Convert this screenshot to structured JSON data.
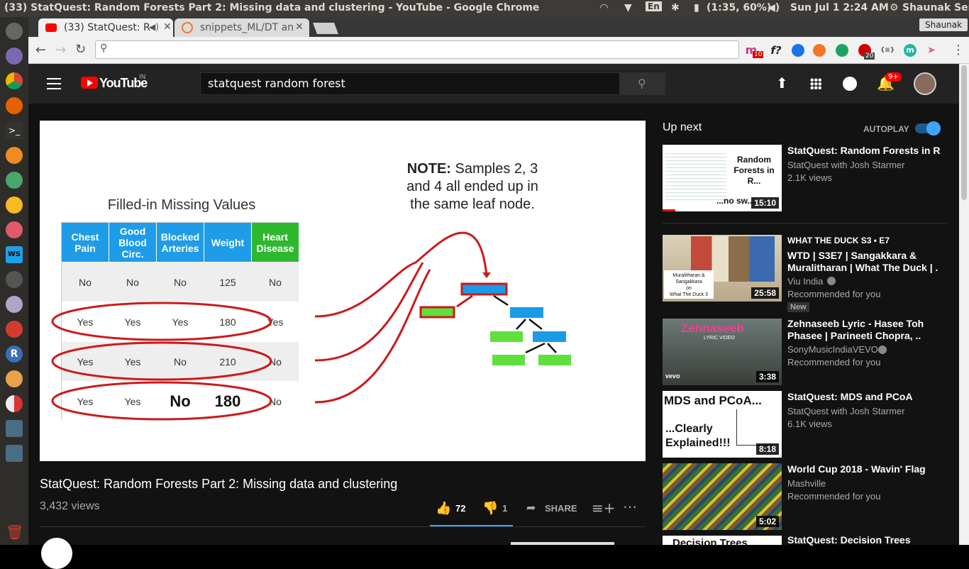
{
  "system": {
    "window_title": "(33) StatQuest: Random Forests Part 2: Missing data and clustering - YouTube - Google Chrome",
    "keyboard_layout": "En",
    "battery": "(1:35, 60%)",
    "datetime": "Sun Jul  1  2:24 AM",
    "user": "Shaunak Sen"
  },
  "browser": {
    "profile": "Shaunak",
    "tabs": [
      {
        "label": "(33) StatQuest: R",
        "active": true
      },
      {
        "label": "snippets_ML/DT an",
        "active": false
      }
    ],
    "address": "",
    "extensions": {
      "badge1": "10",
      "fx": "f?",
      "badge2": "20",
      "braces": "{≡}",
      "m": "m"
    }
  },
  "youtube": {
    "logo_text": "YouTube",
    "region": "IN",
    "search_value": "statquest random forest",
    "notifications_badge": "9+"
  },
  "slide": {
    "table_title": "Filled-in Missing Values",
    "note_bold": "NOTE:",
    "note_line1": " Samples 2, 3",
    "note_line2": "and 4 all ended up in",
    "note_line3": "the same leaf node.",
    "headers": [
      "Chest Pain",
      "Good Blood Circ.",
      "Blocked Arteries",
      "Weight",
      "Heart Disease"
    ],
    "rows": [
      [
        "No",
        "No",
        "No",
        "125",
        "No"
      ],
      [
        "Yes",
        "Yes",
        "Yes",
        "180",
        "Yes"
      ],
      [
        "Yes",
        "Yes",
        "No",
        "210",
        "No"
      ],
      [
        "Yes",
        "Yes",
        "No",
        "180",
        "No"
      ]
    ]
  },
  "video": {
    "title": "StatQuest: Random Forests Part 2: Missing data and clustering",
    "views": "3,432 views",
    "likes": "72",
    "dislikes": "1",
    "share": "SHARE"
  },
  "sidebar": {
    "heading": "Up next",
    "autoplay": "AUTOPLAY",
    "autoplay_on": true,
    "videos": [
      {
        "title": "StatQuest: Random Forests in R",
        "channel": "StatQuest with Josh Starmer",
        "meta": "2.1K views",
        "duration": "15:10",
        "thumb_line1": "Random",
        "thumb_line2": "Forests in",
        "thumb_line3": "R...",
        "thumb_line4": "...no sw..."
      },
      {
        "title": "WTD | S3E7 | Sangakkara & Muralitharan | What The Duck | .",
        "channel": "Viu India",
        "meta": "Recommended for you",
        "duration": "25:58",
        "tag": "WHAT THE DUCK  S3 • E7",
        "badge": "New",
        "thumb_line1": "Muralitharan &",
        "thumb_line2": "Sangakkara",
        "thumb_line3": "on",
        "thumb_line4": "What The Duck 3"
      },
      {
        "title": "Zehnaseeb Lyric - Hasee Toh Phasee | Parineeti Chopra, ..",
        "channel": "SonyMusicIndiaVEVO",
        "meta": "Recommended for you",
        "duration": "3:38",
        "thumb_line1": "Zehnaseeb",
        "thumb_line2": "LYRIC VIDEO",
        "thumb_line3": "vevo"
      },
      {
        "title": "StatQuest: MDS and PCoA",
        "channel": "StatQuest with Josh Starmer",
        "meta": "6.1K views",
        "duration": "8:18",
        "thumb_line1": "MDS and PCoA...",
        "thumb_line2": "...Clearly",
        "thumb_line3": "Explained!!!"
      },
      {
        "title": "World Cup 2018 - Wavin' Flag",
        "channel": "Mashville",
        "meta": "Recommended for you",
        "duration": "5:02"
      },
      {
        "title": "StatQuest: Decision Trees",
        "thumb_line1": "Decision Trees"
      }
    ]
  },
  "colors": {
    "yt_red": "#ff0000",
    "header_blue": "#1e9ce8",
    "header_green": "#2eb82e",
    "oval_red": "#cc1a1a",
    "tree_blue": "#1a9be8",
    "tree_green": "#5fe03c",
    "autoplay_blue": "#3ea6ff"
  }
}
